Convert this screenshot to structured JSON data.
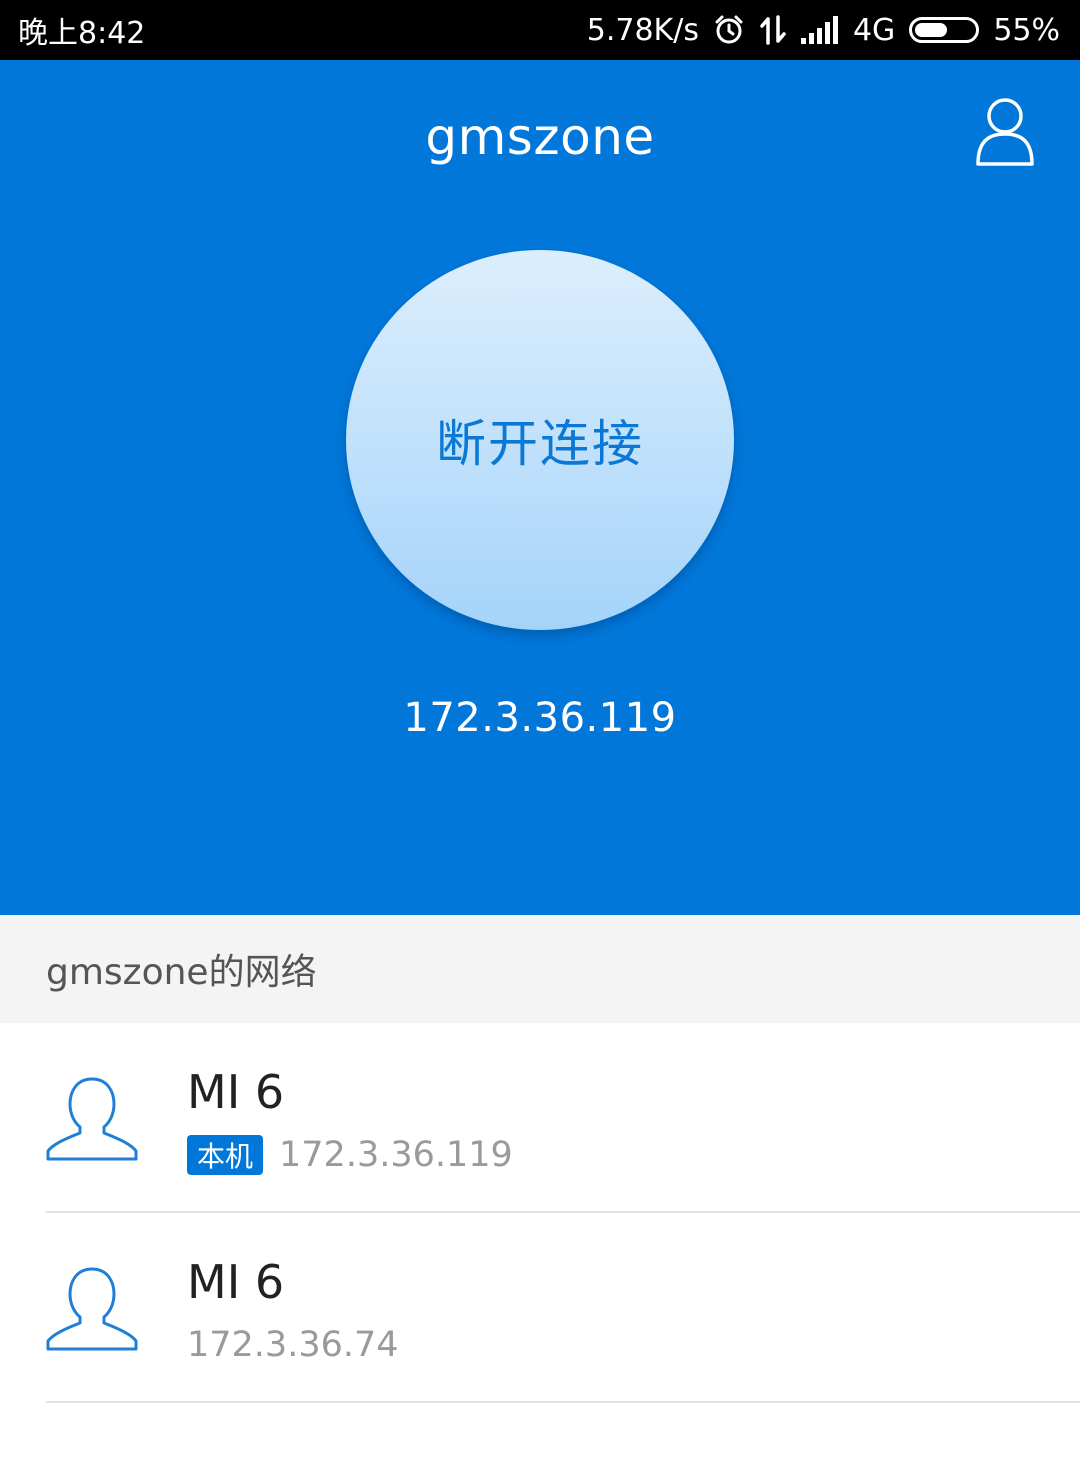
{
  "status_bar": {
    "time": "晚上8:42",
    "net_speed": "5.78K/s",
    "network_type": "4G",
    "battery": "55%",
    "battery_level": 0.55,
    "icons": [
      "alarm-icon",
      "data-transfer-icon",
      "signal-icon",
      "battery-icon"
    ]
  },
  "header": {
    "title": "gmszone",
    "profile_icon": "user-outline-icon"
  },
  "connection": {
    "button_label": "断开连接",
    "ip": "172.3.36.119"
  },
  "network": {
    "section_title": "gmszone的网络",
    "devices": [
      {
        "name": "MI 6",
        "badge": "本机",
        "ip": "172.3.36.119",
        "icon": "person-icon"
      },
      {
        "name": "MI 6",
        "badge": "",
        "ip": "172.3.36.74",
        "icon": "person-icon"
      }
    ]
  },
  "colors": {
    "primary": "#0077d9",
    "circle_text": "#0a78d4",
    "section_bg": "#f4f4f4",
    "secondary_text": "#9a9a9a"
  }
}
